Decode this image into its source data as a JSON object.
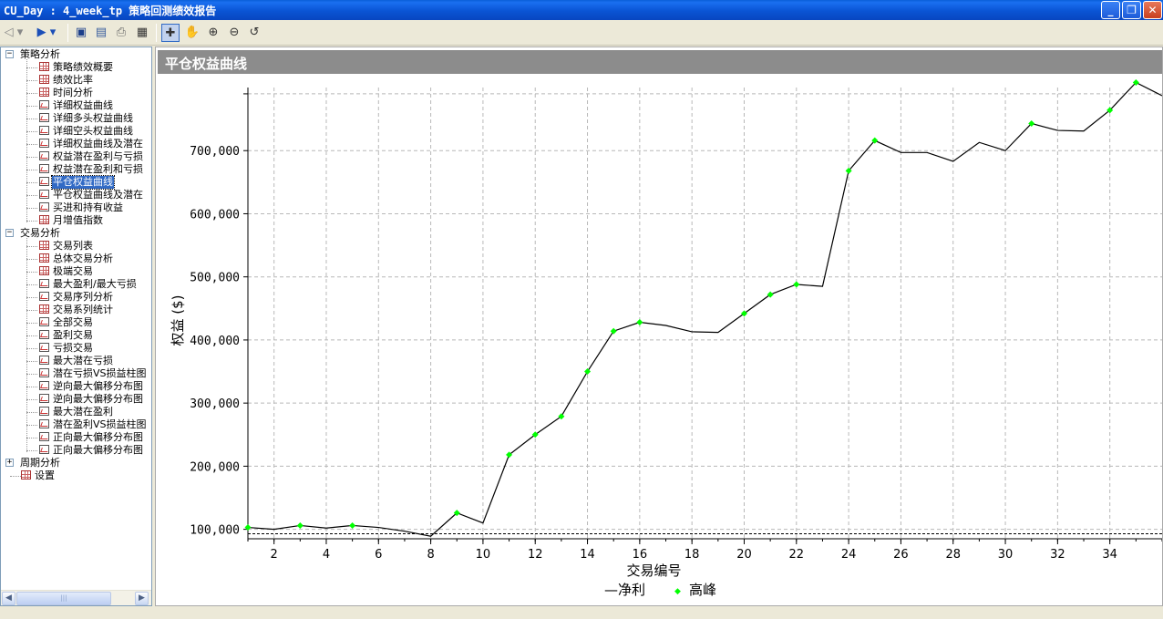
{
  "window": {
    "title": "CU_Day : 4_week_tp 策略回测绩效报告",
    "minimize_label": "_",
    "maximize_label": "❐",
    "close_label": "✕"
  },
  "toolbar": {
    "icons": [
      "back-icon",
      "forward-icon",
      "save-icon",
      "print-preview-icon",
      "print-icon",
      "data-window-icon",
      "select-icon",
      "pan-hand-icon",
      "zoom-in-icon",
      "zoom-out-icon",
      "reset-zoom-icon"
    ]
  },
  "tree": {
    "groups": [
      {
        "label": "策略分析",
        "expanded": true,
        "items": [
          {
            "label": "策略绩效概要",
            "icon": "grid"
          },
          {
            "label": "绩效比率",
            "icon": "grid"
          },
          {
            "label": "时间分析",
            "icon": "grid"
          },
          {
            "label": "详细权益曲线",
            "icon": "chart"
          },
          {
            "label": "详细多头权益曲线",
            "icon": "chart"
          },
          {
            "label": "详细空头权益曲线",
            "icon": "chart"
          },
          {
            "label": "详细权益曲线及潜在",
            "icon": "chart"
          },
          {
            "label": "权益潜在盈利与亏损",
            "icon": "chart"
          },
          {
            "label": "权益潜在盈利和亏损",
            "icon": "chart"
          },
          {
            "label": "平仓权益曲线",
            "icon": "chart",
            "selected": true
          },
          {
            "label": "平仓权益曲线及潜在",
            "icon": "chart"
          },
          {
            "label": "买进和持有收益",
            "icon": "chart"
          },
          {
            "label": "月增值指数",
            "icon": "grid"
          }
        ]
      },
      {
        "label": "交易分析",
        "expanded": true,
        "items": [
          {
            "label": "交易列表",
            "icon": "grid"
          },
          {
            "label": "总体交易分析",
            "icon": "grid"
          },
          {
            "label": "极端交易",
            "icon": "grid"
          },
          {
            "label": "最大盈利/最大亏损",
            "icon": "chart"
          },
          {
            "label": "交易序列分析",
            "icon": "chart"
          },
          {
            "label": "交易系列统计",
            "icon": "grid"
          },
          {
            "label": "全部交易",
            "icon": "chart"
          },
          {
            "label": "盈利交易",
            "icon": "chart"
          },
          {
            "label": "亏损交易",
            "icon": "chart"
          },
          {
            "label": "最大潜在亏损",
            "icon": "chart"
          },
          {
            "label": "潜在亏损VS损益柱图",
            "icon": "chart"
          },
          {
            "label": "逆向最大偏移分布图",
            "icon": "chart"
          },
          {
            "label": "逆向最大偏移分布图",
            "icon": "chart"
          },
          {
            "label": "最大潜在盈利",
            "icon": "chart"
          },
          {
            "label": "潜在盈利VS损益柱图",
            "icon": "chart"
          },
          {
            "label": "正向最大偏移分布图",
            "icon": "chart"
          },
          {
            "label": "正向最大偏移分布图",
            "icon": "chart"
          }
        ]
      },
      {
        "label": "周期分析",
        "expanded": false,
        "items": []
      }
    ],
    "settings_label": "设置",
    "scroll_left": "◀",
    "scroll_right": "▶",
    "scroll_grip": "|||"
  },
  "panel": {
    "title": "平仓权益曲线"
  },
  "chart_data": {
    "type": "line",
    "xlabel": "交易编号",
    "ylabel": "权益 ($)",
    "x_ticks": [
      2,
      4,
      6,
      8,
      10,
      12,
      14,
      16,
      18,
      20,
      22,
      24,
      26,
      28,
      30,
      32,
      34
    ],
    "y_ticks": [
      100000,
      200000,
      300000,
      400000,
      500000,
      600000,
      700000
    ],
    "y_tick_labels": [
      "100,000",
      "200,000",
      "300,000",
      "400,000",
      "500,000",
      "600,000",
      "700,000"
    ],
    "xlim": [
      1,
      36
    ],
    "ylim": [
      85000,
      800000
    ],
    "grid": true,
    "baseline": 93000,
    "legend": {
      "position": "bottom",
      "line_label": "净利",
      "marker_label": "高峰",
      "line_symbol": "—",
      "marker_symbol": "◆"
    },
    "colors": {
      "line": "#000000",
      "peak": "#00ff00",
      "grid": "#b8b8b8"
    },
    "series": [
      {
        "name": "净利",
        "x": [
          1,
          2,
          3,
          4,
          5,
          6,
          7,
          8,
          9,
          10,
          11,
          12,
          13,
          14,
          15,
          16,
          17,
          18,
          19,
          20,
          21,
          22,
          23,
          24,
          25,
          26,
          27,
          28,
          29,
          30,
          31,
          32,
          33,
          34,
          35,
          36
        ],
        "y": [
          103000,
          100000,
          106000,
          102000,
          106000,
          103000,
          97000,
          89000,
          126000,
          110000,
          218000,
          250000,
          279000,
          350000,
          414000,
          428000,
          423000,
          413000,
          412000,
          442000,
          472000,
          488000,
          485000,
          668000,
          716000,
          697000,
          697000,
          683000,
          713000,
          700000,
          743000,
          732000,
          731000,
          764000,
          808000,
          787000
        ]
      },
      {
        "name": "高峰",
        "x": [
          1,
          3,
          5,
          9,
          11,
          12,
          13,
          14,
          15,
          16,
          20,
          21,
          22,
          24,
          25,
          31,
          34,
          35
        ],
        "y": [
          103000,
          106000,
          106000,
          126000,
          218000,
          250000,
          279000,
          350000,
          414000,
          428000,
          442000,
          472000,
          488000,
          668000,
          716000,
          743000,
          764000,
          808000
        ]
      }
    ]
  }
}
